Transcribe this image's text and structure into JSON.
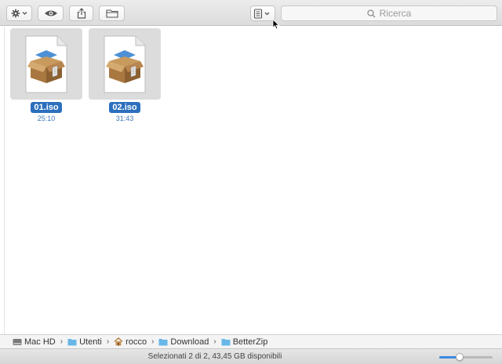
{
  "toolbar": {
    "buttons": [
      {
        "name": "action-menu",
        "icon": "gear-icon"
      },
      {
        "name": "quick-look",
        "icon": "eye-icon"
      },
      {
        "name": "share",
        "icon": "share-icon"
      },
      {
        "name": "new-folder",
        "icon": "folder-icon"
      },
      {
        "name": "group-by",
        "icon": "group-icon"
      }
    ],
    "search_placeholder": "Ricerca"
  },
  "files": [
    {
      "name": "01.iso",
      "meta": "25:10",
      "icon": "archive-box-icon"
    },
    {
      "name": "02.iso",
      "meta": "31:43",
      "icon": "archive-box-icon"
    }
  ],
  "pathbar": {
    "items": [
      {
        "label": "Mac HD",
        "icon": "disk-icon"
      },
      {
        "label": "Utenti",
        "icon": "folder-icon"
      },
      {
        "label": "rocco",
        "icon": "home-icon"
      },
      {
        "label": "Download",
        "icon": "folder-icon"
      },
      {
        "label": "BetterZip",
        "icon": "folder-icon"
      }
    ]
  },
  "status": {
    "text": "Selezionati 2 di 2, 43,45 GB disponibili",
    "icon_size_level": 0.38
  },
  "colors": {
    "selection": "#2c6fbd",
    "folder": "#69b7e8",
    "accent": "#3d89e0"
  }
}
